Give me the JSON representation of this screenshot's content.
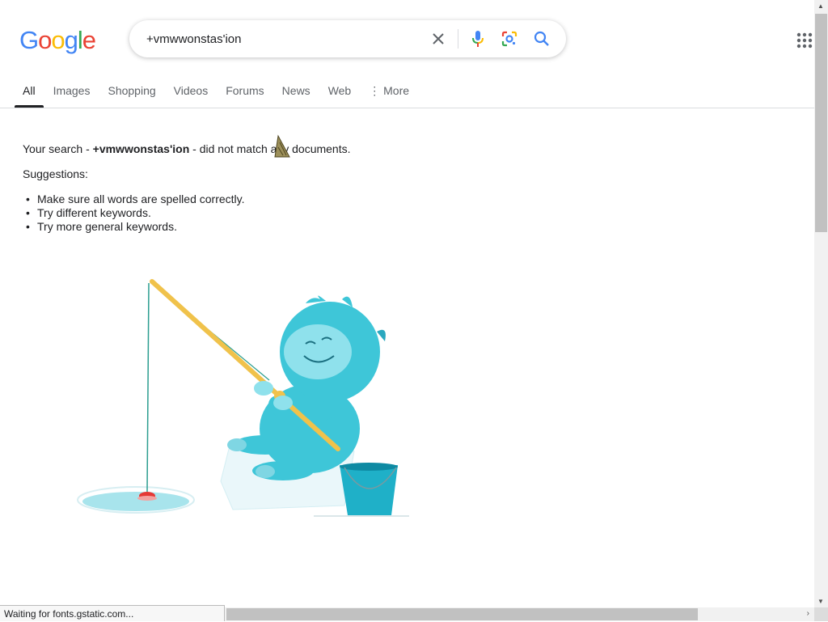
{
  "header": {
    "logo": [
      "G",
      "o",
      "o",
      "g",
      "l",
      "e"
    ],
    "search_value": "+vmwwonstas'ion"
  },
  "tabs": [
    {
      "label": "All",
      "active": true
    },
    {
      "label": "Images"
    },
    {
      "label": "Shopping"
    },
    {
      "label": "Videos"
    },
    {
      "label": "Forums"
    },
    {
      "label": "News"
    },
    {
      "label": "Web"
    },
    {
      "label": "More",
      "prefix": "⋮"
    }
  ],
  "results": {
    "msg_prefix": "Your search - ",
    "query": "+vmwwonstas'ion",
    "msg_suffix": " - did not match any documents.",
    "suggestions_title": "Suggestions:",
    "suggestions": [
      "Make sure all words are spelled correctly.",
      "Try different keywords.",
      "Try more general keywords."
    ]
  },
  "status_bar": "Waiting for fonts.gstatic.com...",
  "colors": {
    "blue": "#4285f4",
    "red": "#ea4335",
    "yellow": "#fbbc05",
    "green": "#34a853",
    "monster": "#3ec6d8"
  }
}
